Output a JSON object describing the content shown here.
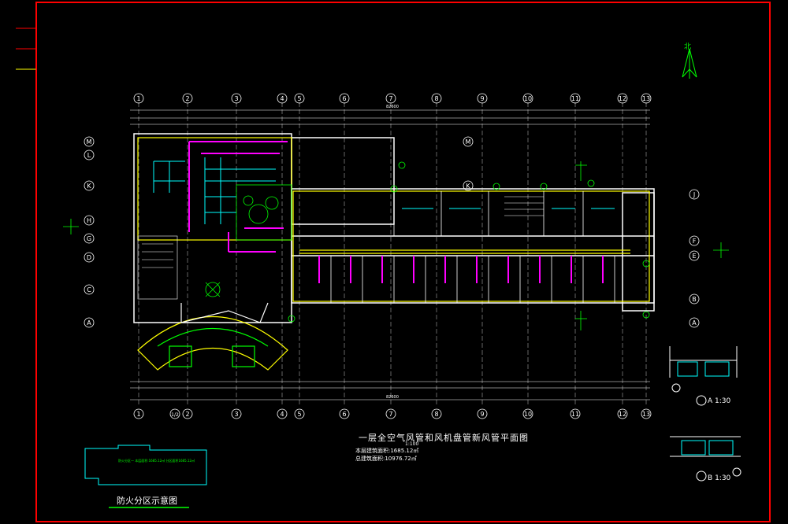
{
  "drawing": {
    "title": "一层全空气风管和风机盘管新风管平面图",
    "scale": "1:100",
    "area_line1": "本层建筑面积:1685.12㎡",
    "area_line2": "总建筑面积:10976.72㎡",
    "fire_zone_title": "防火分区示意图",
    "fire_zone_note": "防火分区一 本层面积:1685.12㎡ 分区面积1685.12㎡",
    "detail_a_label": "A",
    "detail_a_scale": "1:30",
    "detail_b_label": "B",
    "detail_b_scale": "1:30",
    "north_label": "北",
    "total_dim": "82600"
  },
  "axes_top": [
    "1",
    "2",
    "3",
    "4",
    "5",
    "6",
    "7",
    "8",
    "9",
    "10",
    "11",
    "12",
    "13"
  ],
  "axes_bottom": [
    "1",
    "1/2",
    "2",
    "3",
    "4",
    "5",
    "6",
    "7",
    "8",
    "9",
    "10",
    "11",
    "12",
    "13"
  ],
  "axes_left": [
    "M",
    "L",
    "K",
    "H",
    "G",
    "D",
    "C",
    "A"
  ],
  "axes_mid": [
    "M",
    "K"
  ],
  "axes_right": [
    "J",
    "F",
    "E",
    "B",
    "A"
  ],
  "section_marks": {
    "left": "1",
    "right": "1",
    "top": "2",
    "bottom": "2"
  },
  "colors": {
    "frame": "#ff0000",
    "wall": "#ffffff",
    "duct_supply": "#ff00ff",
    "duct_fresh": "#ffff00",
    "duct_cyan": "#00ffff",
    "annotation": "#00ff00",
    "axis_circle": "#ffffff"
  }
}
